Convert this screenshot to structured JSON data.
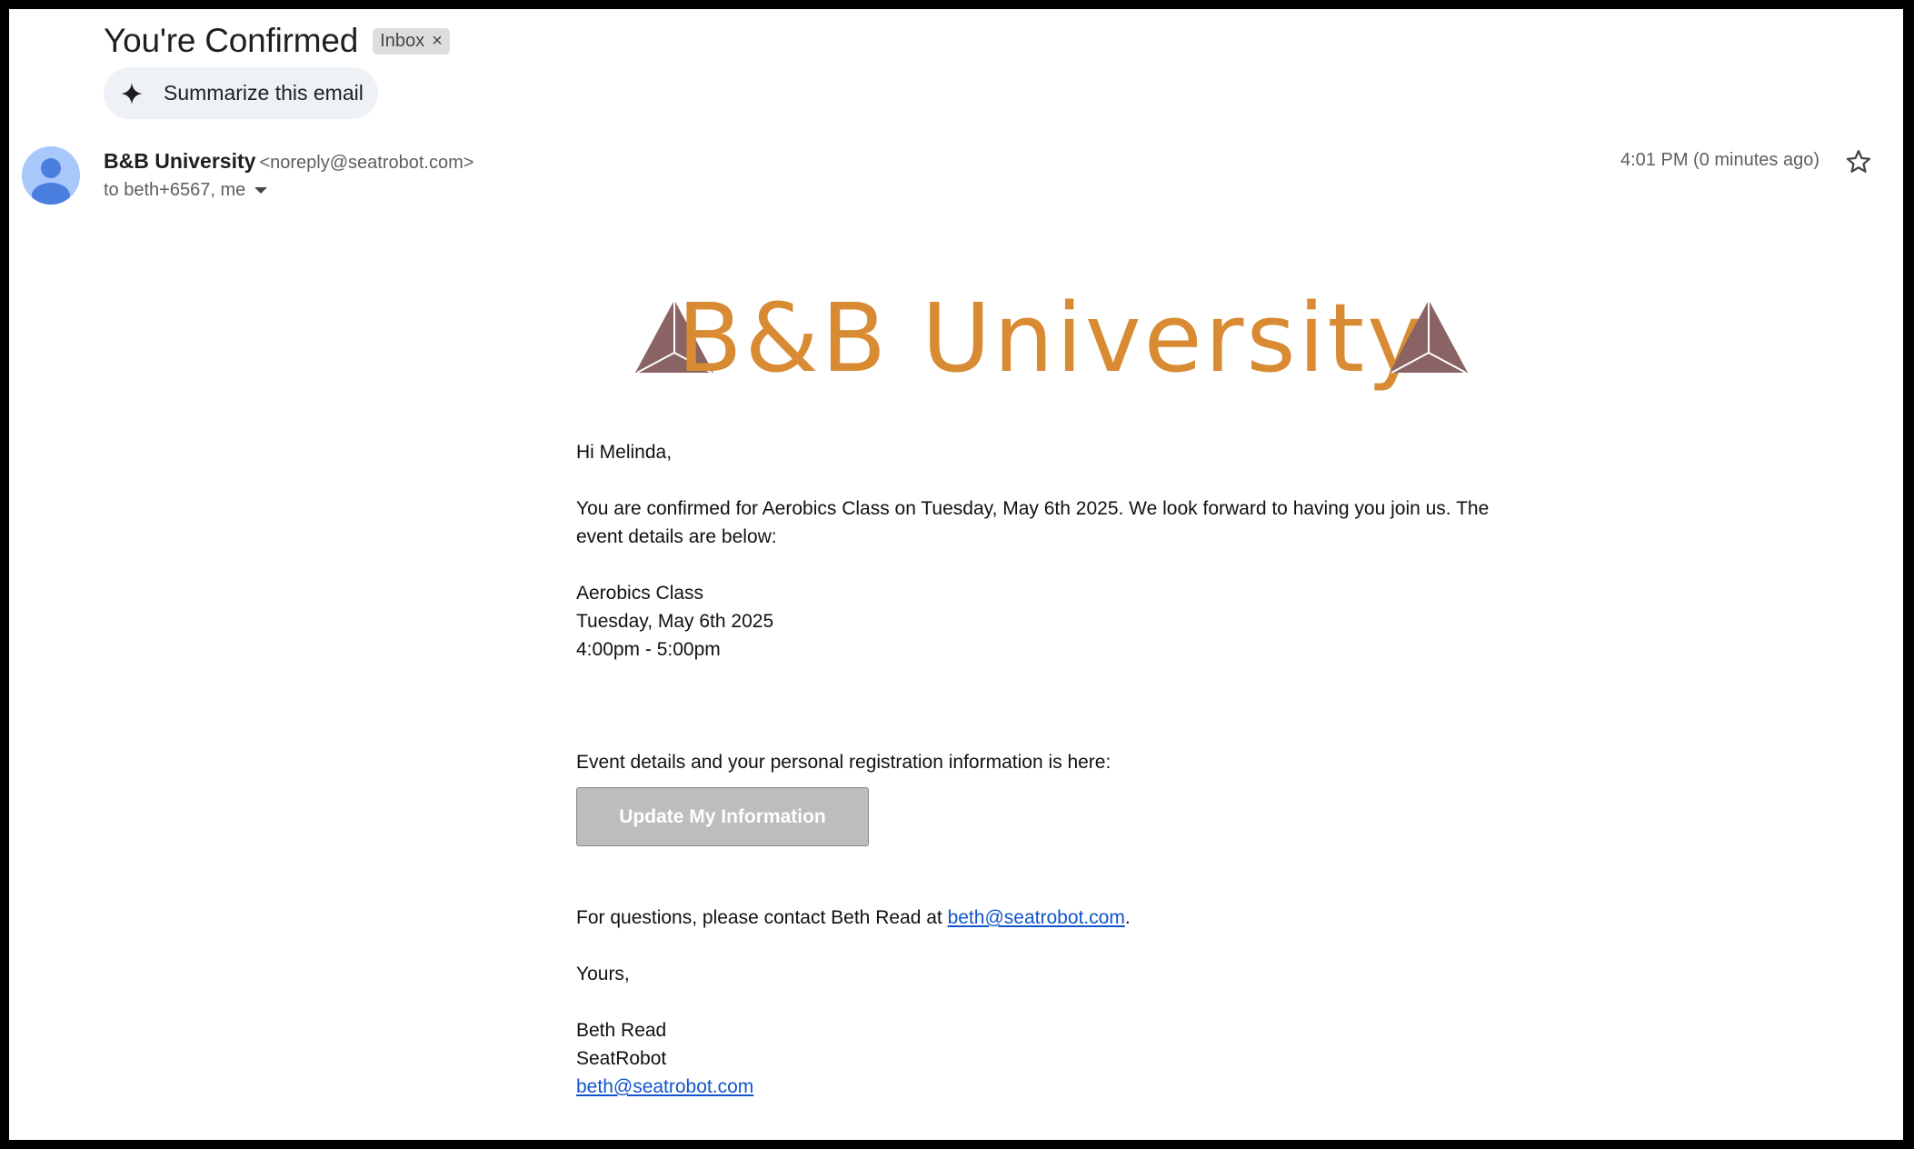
{
  "header": {
    "subject": "You're Confirmed",
    "label": "Inbox",
    "label_remove": "×",
    "summarize_label": "Summarize this email"
  },
  "sender": {
    "name": "B&B University",
    "email": "<noreply@seatrobot.com>",
    "recipients": "to beth+6567, me",
    "time": "4:01 PM (0 minutes ago)"
  },
  "logo": {
    "text": "B&B University",
    "text_color": "#d98b33",
    "triangle_color": "#8a6464"
  },
  "body": {
    "greeting": "Hi Melinda,",
    "intro_line1": "You are confirmed for Aerobics Class on Tuesday, May 6th 2025. We look forward to having you join us. The",
    "intro_line2": "event details are below:",
    "event_name": "Aerobics Class",
    "event_date": "Tuesday, May 6th 2025",
    "event_time": "4:00pm - 5:00pm",
    "details_line": "Event details and your personal registration information is here:",
    "update_button": "Update My Information",
    "questions_prefix": "For questions, please contact Beth Read at ",
    "questions_email": "beth@seatrobot.com",
    "questions_suffix": ".",
    "closing": "Yours,",
    "signature_name": "Beth Read",
    "signature_company": "SeatRobot",
    "signature_email": "beth@seatrobot.com"
  },
  "colors": {
    "link": "#1155cc",
    "button_bg": "#bdbdbd",
    "avatar_bg": "#a8c7fa",
    "avatar_fg": "#4a7fe0"
  }
}
